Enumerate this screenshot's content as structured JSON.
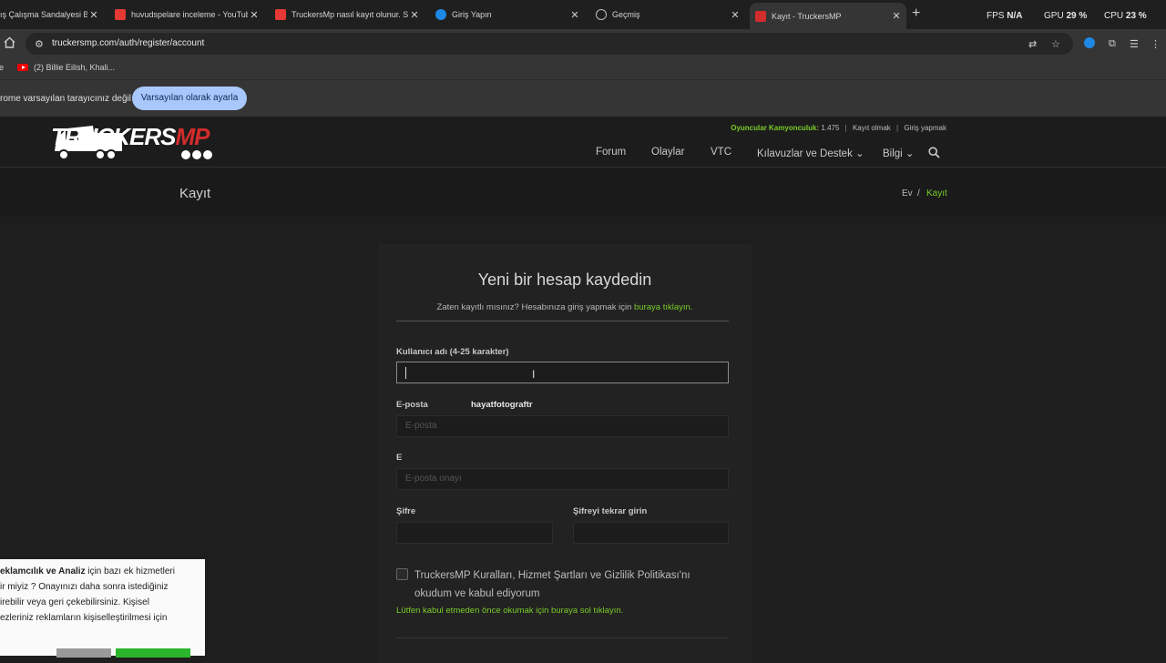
{
  "browser": {
    "tabs": [
      {
        "title": "ış Çalışma Sandalyesi B",
        "color": "#9e9e9e"
      },
      {
        "title": "huvudspelare inceleme - YouTube",
        "color": "#e53935"
      },
      {
        "title": "TruckersMp nasıl kayıt olunur. Siz",
        "color": "#e53935"
      },
      {
        "title": "Giriş Yapın",
        "color": "#1e88e5"
      },
      {
        "title": "Geçmiş",
        "color": "#9e9e9e"
      },
      {
        "title": "Kayıt - TruckersMP",
        "color": "#d22c2c"
      }
    ],
    "new_tab": "+",
    "perf": {
      "fps_label": "FPS",
      "fps_value": "N/A",
      "gpu_label": "GPU",
      "gpu_value": "29 %",
      "cpu_label": "CPU",
      "cpu_value": "23 %"
    },
    "url": "truckersmp.com/auth/register/account",
    "bookmarks": [
      {
        "label": "be"
      },
      {
        "label": "(2) Billie Eilish, Khali..."
      }
    ],
    "infobar": {
      "message": "rome varsayılan tarayıcınız değil",
      "button": "Varsayılan olarak ayarla"
    }
  },
  "site": {
    "logo": {
      "part1": "TRUCKERS",
      "part2": "MP"
    },
    "topline": {
      "players_label": "Oyuncular Kamyonculuk:",
      "players_count": "1.475",
      "register": "Kayıt olmak",
      "login": "Giriş yapmak"
    },
    "nav": [
      "Forum",
      "Olaylar",
      "VTC",
      "Kılavuzlar ve Destek ⌄",
      "Bilgi ⌄"
    ],
    "page_title": "Kayıt",
    "breadcrumb": {
      "home": "Ev",
      "sep": "/",
      "current": "Kayıt"
    },
    "accent": "#7acc29"
  },
  "form": {
    "heading": "Yeni bir hesap kaydedin",
    "subtitle_prefix": "Zaten kayıtlı mısınız? Hesabınıza giriş yapmak için",
    "subtitle_link": "buraya tıklayın.",
    "username_label": "Kullanıcı adı (4-25 karakter)",
    "username_value": "",
    "email_label": "E-posta",
    "email_placeholder": "E-posta",
    "autocomplete_suggestion": "hayatfotograftr",
    "email_confirm_label": "E",
    "email_confirm_placeholder": "E-posta onayı",
    "password_label": "Şifre",
    "password_confirm_label": "Şifreyi tekrar girin",
    "terms_text": "TruckersMP Kuralları, Hizmet Şartları ve Gizlilik Politikası'nı okudum ve kabul ediyorum",
    "terms_note": "Lütfen kabul etmeden önce okumak için buraya sol tıklayın."
  },
  "cookie": {
    "line1_bold": "eklamcılık ve Analiz",
    "line1_rest": " için bazı ek hizmetleri",
    "line2": "ir miyiz ? Onayınızı daha sonra istediğiniz",
    "line3": "irebilir veya geri çekebilirsiniz. Kişisel",
    "line4": "ezleriniz reklamların kişiselleştirilmesi için"
  }
}
